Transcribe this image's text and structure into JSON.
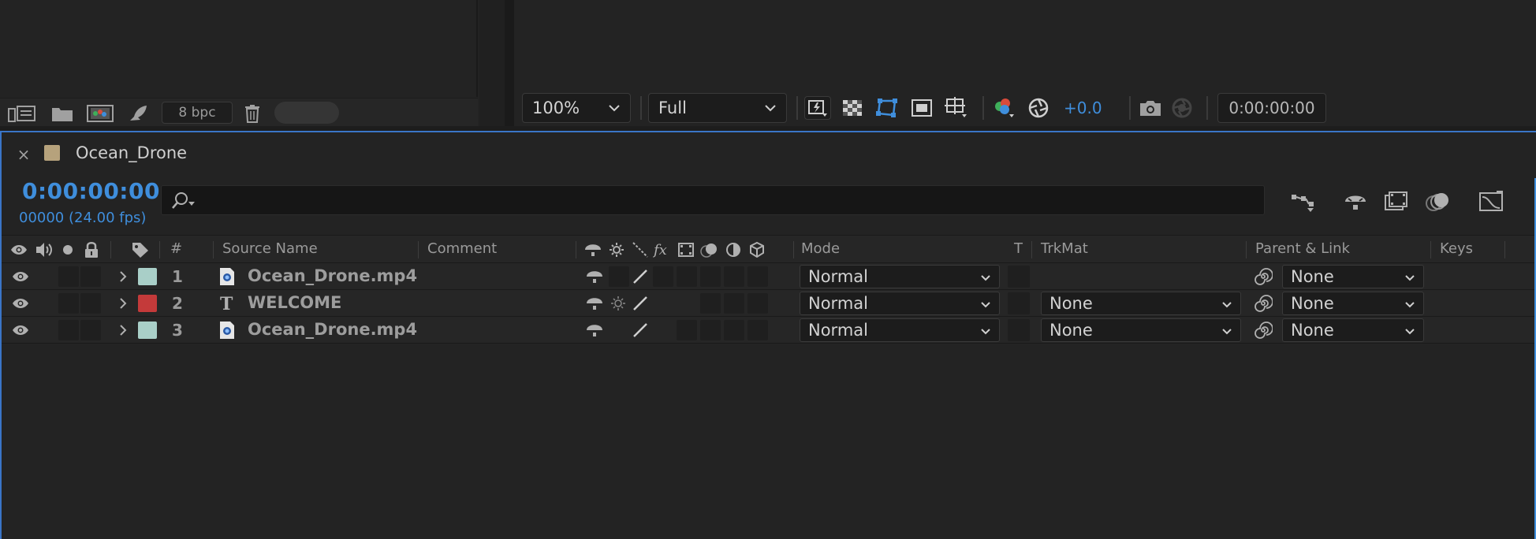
{
  "project_panel": {
    "bit_depth": "8 bpc",
    "icons": [
      "interpret-footage-icon",
      "new-folder-icon",
      "new-composition-icon",
      "render-queue-icon",
      "trash-icon"
    ]
  },
  "viewer": {
    "zoom": "100%",
    "resolution": "Full",
    "exposure": "+0.0",
    "timecode": "0:00:00:00"
  },
  "timeline": {
    "tab_title": "Ocean_Drone",
    "tab_color": "#b6a27c",
    "current_time": "0:00:00:00",
    "frame_info": "00000 (24.00 fps)",
    "columns": {
      "number": "#",
      "source_name": "Source Name",
      "comment": "Comment",
      "mode": "Mode",
      "t": "T",
      "trkmat": "TrkMat",
      "parent": "Parent & Link",
      "keys": "Keys"
    },
    "layers": [
      {
        "index": "1",
        "name": "Ocean_Drone.mp4",
        "type": "footage",
        "label_color": "#a9cfc8",
        "mode": "Normal",
        "trkmat": "",
        "parent": "None"
      },
      {
        "index": "2",
        "name": "WELCOME",
        "type": "text",
        "label_color": "#c43a3a",
        "mode": "Normal",
        "trkmat": "None",
        "parent": "None"
      },
      {
        "index": "3",
        "name": "Ocean_Drone.mp4",
        "type": "footage",
        "label_color": "#a9cfc8",
        "mode": "Normal",
        "trkmat": "None",
        "parent": "None"
      }
    ]
  },
  "colors": {
    "accent": "#3f8edc",
    "panel": "#232323"
  }
}
